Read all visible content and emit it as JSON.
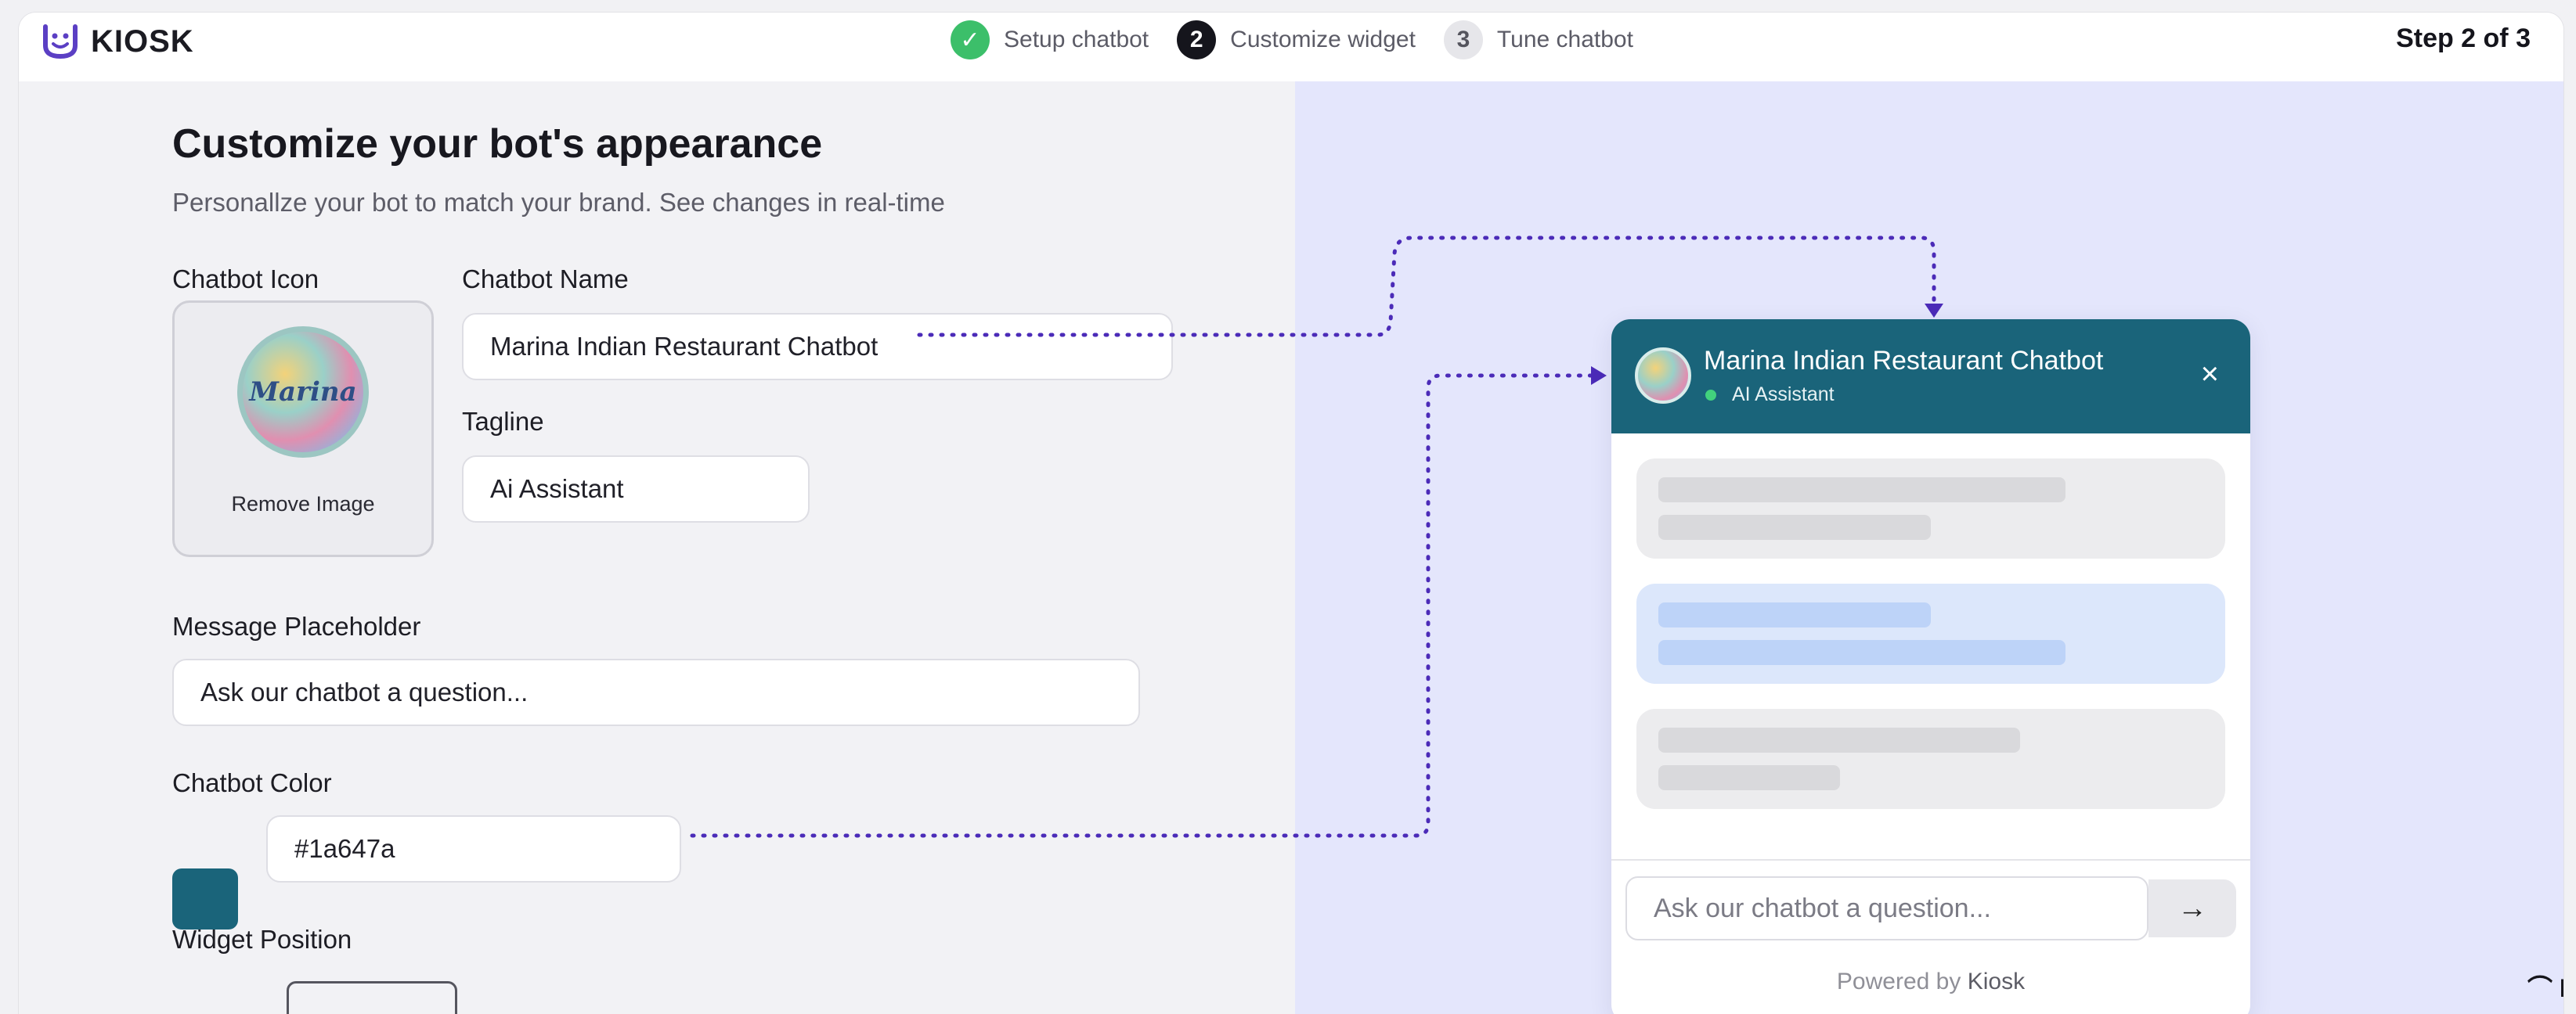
{
  "app": {
    "brand": "KIOSK"
  },
  "steps": [
    {
      "label": "Setup chatbot",
      "state": "done",
      "marker": "✓"
    },
    {
      "label": "Customize widget",
      "state": "active",
      "marker": "2"
    },
    {
      "label": "Tune chatbot",
      "state": "todo",
      "marker": "3"
    }
  ],
  "step_count": "Step 2 of 3",
  "form": {
    "title": "Customize your bot's appearance",
    "subtitle": "Personallze your bot to match your brand. See changes in real-time",
    "icon_label": "Chatbot Icon",
    "icon_initials": "Marina",
    "remove_image": "Remove Image",
    "name_label": "Chatbot Name",
    "name_value": "Marina Indian Restaurant Chatbot",
    "tagline_label": "Tagline",
    "tagline_value": "Ai Assistant",
    "placeholder_label": "Message Placeholder",
    "placeholder_value": "Ask our chatbot a question...",
    "color_label": "Chatbot Color",
    "color_value": "#1a647a",
    "position_label": "Widget Position"
  },
  "preview": {
    "title": "Marina Indian Restaurant Chatbot",
    "status": "AI Assistant",
    "close": "×",
    "input_placeholder": "Ask our chatbot a question...",
    "send": "→",
    "powered_prefix": "Powered by",
    "powered_brand": "Kiosk"
  },
  "corner_text": "N",
  "colors": {
    "accent": "#1a647a",
    "preview_bg": "#e4e6fc",
    "connector": "#4b2bb8"
  }
}
